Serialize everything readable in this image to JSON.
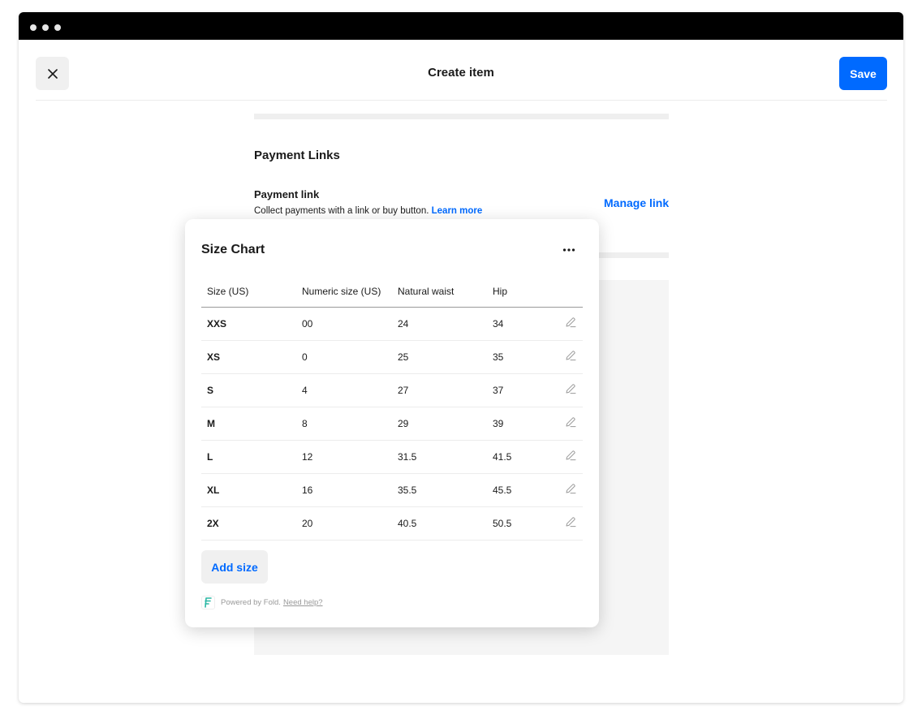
{
  "window": {
    "controls": [
      "dot",
      "dot",
      "dot"
    ]
  },
  "header": {
    "title": "Create item",
    "save_label": "Save",
    "close_icon": "close-icon"
  },
  "payment_links": {
    "section_title": "Payment Links",
    "link_title": "Payment link",
    "description": "Collect payments with a link or buy button.",
    "learn_more": "Learn more",
    "manage_link": "Manage link"
  },
  "size_chart": {
    "title": "Size Chart",
    "more_icon": "more-icon",
    "columns": [
      "Size (US)",
      "Numeric size (US)",
      "Natural waist",
      "Hip"
    ],
    "rows": [
      {
        "size": "XXS",
        "numeric": "00",
        "waist": "24",
        "hip": "34"
      },
      {
        "size": "XS",
        "numeric": "0",
        "waist": "25",
        "hip": "35"
      },
      {
        "size": "S",
        "numeric": "4",
        "waist": "27",
        "hip": "37"
      },
      {
        "size": "M",
        "numeric": "8",
        "waist": "29",
        "hip": "39"
      },
      {
        "size": "L",
        "numeric": "12",
        "waist": "31.5",
        "hip": "41.5"
      },
      {
        "size": "XL",
        "numeric": "16",
        "waist": "35.5",
        "hip": "45.5"
      },
      {
        "size": "2X",
        "numeric": "20",
        "waist": "40.5",
        "hip": "50.5"
      }
    ],
    "edit_icon": "pencil-icon",
    "add_size_label": "Add size",
    "powered_by": "Powered by Fold.",
    "need_help": "Need help?"
  },
  "colors": {
    "accent": "#006aff",
    "titlebar": "#000000",
    "muted": "#f0f0f0"
  }
}
